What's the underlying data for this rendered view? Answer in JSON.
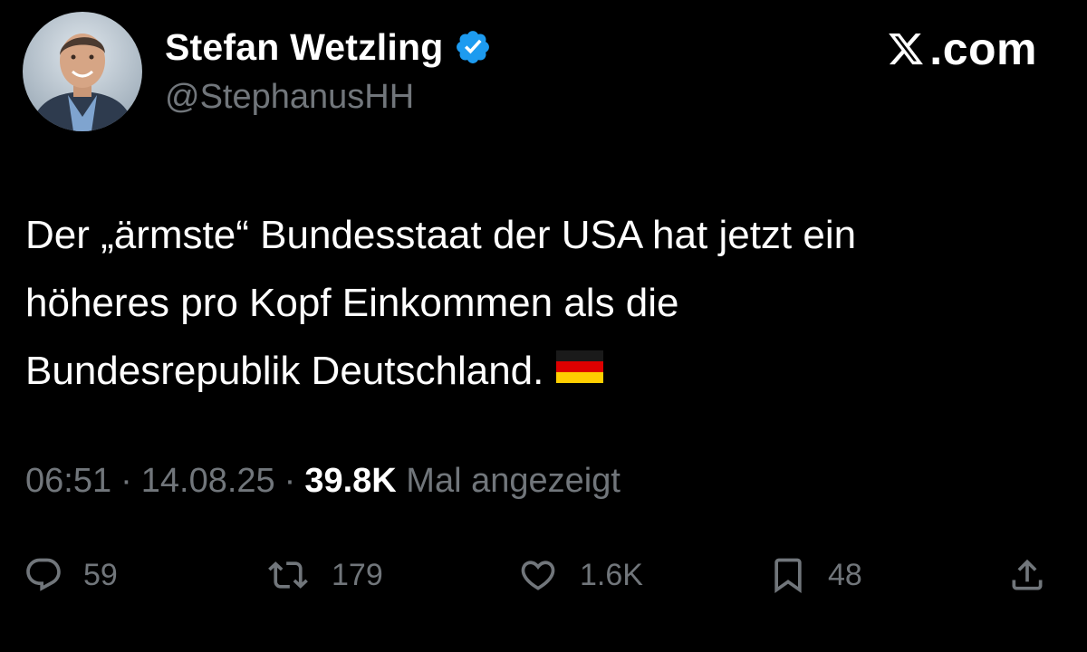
{
  "author": {
    "name": "Stefan Wetzling",
    "handle": "@StephanusHH",
    "verified_icon": "verified-badge-icon",
    "verified_color": "#1d9bf0"
  },
  "brand": {
    "icon": "x-logo-icon",
    "text": ".com"
  },
  "tweet": {
    "lines": [
      "Der „ärmste“ Bundesstaat der USA hat jetzt ein",
      "höheres pro Kopf Einkommen als die",
      "Bundesrepublik Deutschland."
    ],
    "emoji": "germany-flag-icon"
  },
  "meta": {
    "time": "06:51",
    "separator": "·",
    "date": "14.08.25",
    "views_count": "39.8K",
    "views_label": "Mal angezeigt"
  },
  "actions": {
    "replies": "59",
    "retweets": "179",
    "likes": "1.6K",
    "bookmarks": "48"
  },
  "colors": {
    "background": "#000000",
    "text_primary": "#ffffff",
    "text_secondary": "#71767b"
  }
}
